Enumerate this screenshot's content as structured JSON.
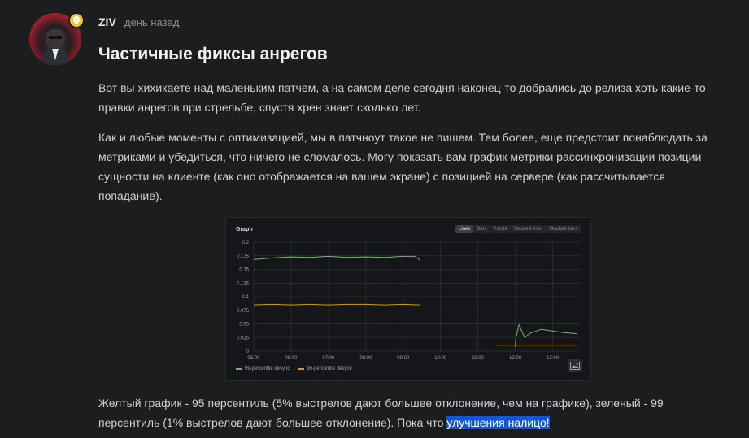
{
  "post": {
    "author": "ZIV",
    "time": "день назад",
    "title": "Частичные фиксы анрегов",
    "paragraph1": "Вот вы хихикаете над маленьким патчем, а на самом деле сегодня наконец-то добрались до релиза хоть какие-то правки анрегов при стрельбе, спустя хрен знает сколько лет.",
    "paragraph2": "Как и любые моменты с оптимизацией, мы в патчноут такое не пишем. Тем более, еще предстоит понаблюдать за метриками и убедиться, что ничего не сломалось. Могу показать вам график метрики рассинхронизации позиции сущности на клиенте (как оно отображается на вашем экране) с позицией на сервере (как рассчитывается попадание).",
    "paragraph3": "Желтый график - 95 персентиль (5% выстрелов дают большее отклонение, чем на графике), зеленый - 99 персентиль (1% выстрелов дают большее отклонение). Пока что ",
    "highlight": "улучшения налицо!"
  },
  "graph": {
    "title": "Graph",
    "tabs": [
      "Lines",
      "Bars",
      "Points",
      "Stacked lines",
      "Stacked bars"
    ],
    "active_tab": "Lines"
  },
  "chart_data": {
    "type": "line",
    "y_ticks": [
      "0",
      "0.025",
      "0.05",
      "0.075",
      "0.1",
      "0.125",
      "0.15",
      "0.175",
      "0.2"
    ],
    "x_ticks": [
      "05:00",
      "06:00",
      "07:00",
      "08:00",
      "09:00",
      "10:00",
      "11:00",
      "12:00",
      "13:00"
    ],
    "ylim": [
      0,
      0.2
    ],
    "xlim": [
      5.0,
      13.75
    ],
    "series": [
      {
        "name": "99-percentile desync",
        "color": "#7eb26d",
        "segments": [
          [
            [
              5.0,
              0.168
            ],
            [
              5.5,
              0.171
            ],
            [
              6.0,
              0.173
            ],
            [
              6.5,
              0.172
            ],
            [
              7.0,
              0.174
            ],
            [
              7.5,
              0.172
            ],
            [
              8.0,
              0.173
            ],
            [
              8.5,
              0.172
            ],
            [
              9.0,
              0.174
            ],
            [
              9.3,
              0.174
            ],
            [
              9.4,
              0.17
            ],
            [
              9.45,
              0.167
            ]
          ],
          [
            [
              12.0,
              0.008
            ],
            [
              12.02,
              0.025
            ],
            [
              12.1,
              0.048
            ],
            [
              12.25,
              0.025
            ],
            [
              12.4,
              0.033
            ],
            [
              12.7,
              0.04
            ],
            [
              13.0,
              0.037
            ],
            [
              13.3,
              0.034
            ],
            [
              13.65,
              0.032
            ]
          ]
        ]
      },
      {
        "name": "95-percentile desync",
        "color": "#cca300",
        "segments": [
          [
            [
              5.0,
              0.085
            ],
            [
              5.5,
              0.086
            ],
            [
              6.0,
              0.085
            ],
            [
              6.5,
              0.086
            ],
            [
              7.0,
              0.085
            ],
            [
              7.5,
              0.086
            ],
            [
              8.0,
              0.086
            ],
            [
              8.5,
              0.085
            ],
            [
              9.0,
              0.086
            ],
            [
              9.45,
              0.085
            ]
          ],
          [
            [
              11.5,
              0.011
            ],
            [
              12.0,
              0.011
            ],
            [
              12.5,
              0.011
            ],
            [
              13.0,
              0.011
            ],
            [
              13.65,
              0.011
            ]
          ]
        ]
      }
    ]
  }
}
